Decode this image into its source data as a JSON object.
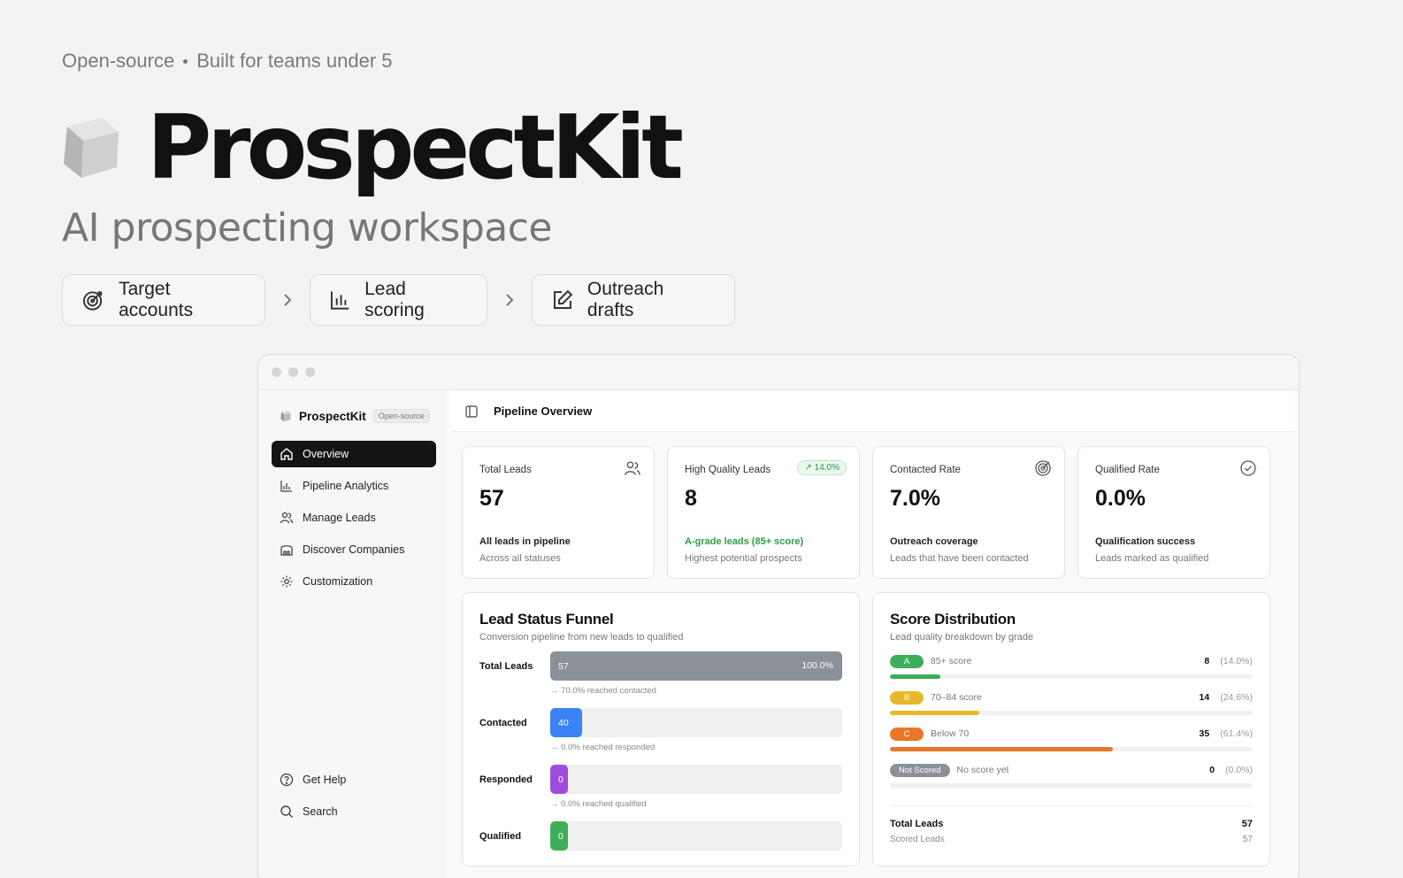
{
  "hero": {
    "tag_left": "Open-source",
    "tag_right": "Built for teams under 5",
    "title": "ProspectKit",
    "subtitle": "AI prospecting workspace",
    "steps": [
      "Target accounts",
      "Lead scoring",
      "Outreach drafts"
    ]
  },
  "app": {
    "brand": "ProspectKit",
    "brand_tag": "Open-source",
    "nav": [
      "Overview",
      "Pipeline Analytics",
      "Manage Leads",
      "Discover Companies",
      "Customization"
    ],
    "nav_bottom": [
      "Get Help",
      "Search"
    ],
    "page_title": "Pipeline Overview"
  },
  "cards": [
    {
      "label": "Total Leads",
      "value": "57",
      "line1": "All leads in pipeline",
      "line2": "Across all statuses",
      "icon": "users-icon"
    },
    {
      "label": "High Quality Leads",
      "value": "8",
      "badge": "14.0%",
      "line1": "A-grade leads (85+ score)",
      "line2": "Highest potential prospects",
      "icon": "trend-up-icon"
    },
    {
      "label": "Contacted Rate",
      "value": "7.0%",
      "line1": "Outreach coverage",
      "line2": "Leads that have been contacted",
      "icon": "target-icon"
    },
    {
      "label": "Qualified Rate",
      "value": "0.0%",
      "line1": "Qualification success",
      "line2": "Leads marked as qualified",
      "icon": "check-circle-icon"
    }
  ],
  "funnel": {
    "title": "Lead Status Funnel",
    "desc": "Conversion pipeline from new leads to qualified",
    "rows": [
      {
        "label": "Total Leads",
        "value": "57",
        "fraction": 1.0,
        "pct": "100.0%",
        "color": "#8b9099",
        "note": "70.0% reached contacted"
      },
      {
        "label": "Contacted",
        "value": "40",
        "fraction": 0.11,
        "pct": "",
        "color": "#3b82f6",
        "note": "0.0% reached responded"
      },
      {
        "label": "Responded",
        "value": "0",
        "fraction": 0.06,
        "pct": "",
        "color": "#9b4de0",
        "note": "0.0% reached qualified"
      },
      {
        "label": "Qualified",
        "value": "0",
        "fraction": 0.06,
        "pct": "",
        "color": "#3fae5a",
        "note": ""
      }
    ]
  },
  "scores": {
    "title": "Score Distribution",
    "desc": "Lead quality breakdown by grade",
    "rows": [
      {
        "grade": "A",
        "label": "85+ score",
        "count": "8",
        "pct": "(14.0%)",
        "fraction": 0.14,
        "color": "#3fae5a"
      },
      {
        "grade": "B",
        "label": "70–84 score",
        "count": "14",
        "pct": "(24.6%)",
        "fraction": 0.246,
        "color": "#e9b82a"
      },
      {
        "grade": "C",
        "label": "Below 70",
        "count": "35",
        "pct": "(61.4%)",
        "fraction": 0.614,
        "color": "#e8772a"
      },
      {
        "grade": "Not Scored",
        "label": "No score yet",
        "count": "0",
        "pct": "(0.0%)",
        "fraction": 0,
        "color": "#8b9099"
      }
    ],
    "total_label": "Total Leads",
    "total_value": "57",
    "scored_label": "Scored Leads",
    "scored_value": "57"
  }
}
